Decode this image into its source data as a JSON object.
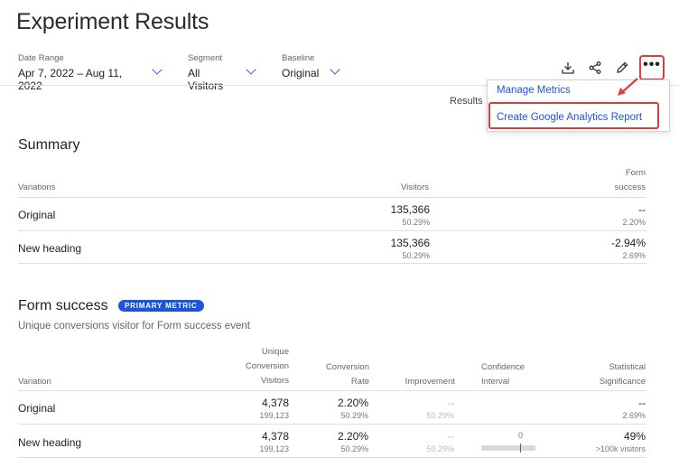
{
  "page": {
    "title": "Experiment Results"
  },
  "filters": [
    {
      "label": "Date Range",
      "value": "Apr 7, 2022 – Aug 11, 2022"
    },
    {
      "label": "Segment",
      "value": "All Visitors"
    },
    {
      "label": "Baseline",
      "value": "Original"
    }
  ],
  "toolbar": {
    "icons": [
      "download-icon",
      "share-icon",
      "pencil-icon",
      "more-icon"
    ]
  },
  "results_label": "Results",
  "menu": {
    "items": [
      "Manage Metrics",
      "Create Google Analytics Report"
    ]
  },
  "colors": {
    "accent": "#1b55d9",
    "highlight": "#e33b3b"
  },
  "summary": {
    "title": "Summary",
    "headers": {
      "variations": "Variations",
      "visitors": "Visitors",
      "metric_line1": "Form",
      "metric_line2": "success"
    },
    "rows": [
      {
        "name": "Original",
        "visitors": "135,366",
        "visitors_pct": "50.29%",
        "metric": "--",
        "metric_sub": "2.20%"
      },
      {
        "name": "New heading",
        "visitors": "135,366",
        "visitors_pct": "50.29%",
        "metric": "-2.94%",
        "metric_sub": "2.69%"
      }
    ]
  },
  "form_success": {
    "title": "Form success",
    "badge": "PRIMARY METRIC",
    "subtitle": "Unique conversions visitor for Form success event",
    "headers": {
      "variation": "Variation",
      "ucv_1": "Unique",
      "ucv_2": "Conversion",
      "ucv_3": "Visitors",
      "cr_1": "Conversion",
      "cr_2": "Rate",
      "improvement": "Improvement",
      "ci_1": "Confidence",
      "ci_2": "Interval",
      "ss_1": "Statistical",
      "ss_2": "Significance"
    },
    "rows": [
      {
        "name": "Original",
        "ucv": "4,378",
        "ucv_sub": "199,123",
        "cr": "2.20%",
        "cr_sub": "50.29%",
        "imp": "--",
        "imp_sub": "50.29%",
        "ci_label": "",
        "sig": "--",
        "sig_sub": "2.69%"
      },
      {
        "name": "New heading",
        "ucv": "4,378",
        "ucv_sub": "199,123",
        "cr": "2.20%",
        "cr_sub": "50.29%",
        "imp": "--",
        "imp_sub": "50.29%",
        "ci_label": "0",
        "sig": "49%",
        "sig_sub": ">100k visitors"
      }
    ]
  }
}
